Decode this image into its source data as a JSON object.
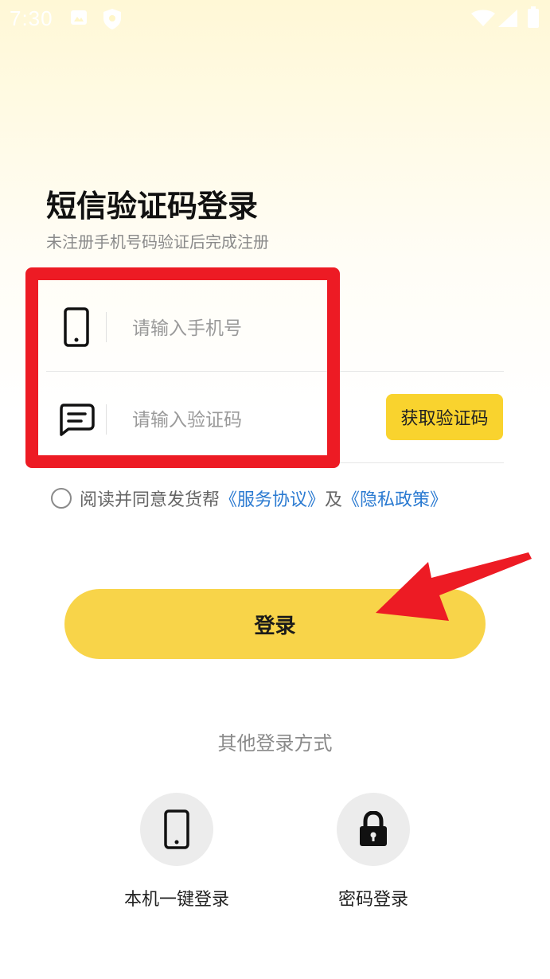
{
  "status_bar": {
    "time": "7:30",
    "icons": [
      "notification-icon",
      "shield-icon",
      "wifi-icon",
      "signal-icon",
      "battery-icon"
    ]
  },
  "login": {
    "title": "短信验证码登录",
    "subtitle": "未注册手机号码验证后完成注册",
    "phone_placeholder": "请输入手机号",
    "code_placeholder": "请输入验证码",
    "get_code_label": "获取验证码",
    "agreement": {
      "prefix": "阅读并同意发货帮",
      "service_link": "《服务协议》",
      "and": "及",
      "privacy_link": "《隐私政策》"
    },
    "login_button": "登录"
  },
  "other_login": {
    "title": "其他登录方式",
    "options": [
      {
        "label": "本机一键登录",
        "icon": "phone-icon"
      },
      {
        "label": "密码登录",
        "icon": "lock-icon"
      }
    ]
  },
  "colors": {
    "accent": "#f8d449",
    "code_button": "#f9d32e",
    "link": "#2a7ad1",
    "annotation": "#ed1b24"
  }
}
